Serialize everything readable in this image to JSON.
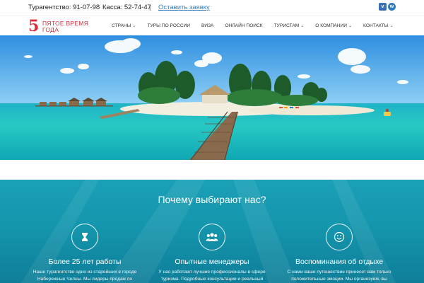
{
  "topbar": {
    "agency_phone": "Турагентство: 91-07-98",
    "cashier_phone": "Касса: 52-74-47",
    "separator": "|",
    "request_link": "Оставить заявку",
    "vimeo_letter": "v",
    "whatsapp_letter": "w"
  },
  "logo": {
    "number": "5",
    "text": "ПЯТОЕ ВРЕМЯ ГОДА"
  },
  "nav": {
    "items": [
      {
        "label": "СТРАНЫ",
        "dropdown": true
      },
      {
        "label": "ТУРЫ ПО РОССИИ",
        "dropdown": false
      },
      {
        "label": "ВИЗА",
        "dropdown": false
      },
      {
        "label": "ОНЛАЙН ПОИСК",
        "dropdown": false
      },
      {
        "label": "ТУРИСТАМ",
        "dropdown": true
      },
      {
        "label": "О КОМПАНИИ",
        "dropdown": true
      },
      {
        "label": "КОНТАКТЫ",
        "dropdown": true
      }
    ],
    "chevron": "⌄"
  },
  "features": {
    "heading": "Почему выбирают нас?",
    "items": [
      {
        "icon": "hourglass-icon",
        "title": "Более 25 лет работы",
        "desc": "Наше турагентство одно из старейших в городе Набережные Челны. Мы лидеры продаж по"
      },
      {
        "icon": "group-icon",
        "title": "Опытные менеджеры",
        "desc": "У нас работают лучшие профессионалы в сфере туризма. Подробные консультации и реальный"
      },
      {
        "icon": "smile-icon",
        "title": "Воспоминания об отдыхе",
        "desc": "С нами ваше путешествие принесет вам только положительные эмоции. Мы организуем, вы"
      }
    ]
  },
  "colors": {
    "brand_red": "#d92d3a",
    "link_blue": "#3a7fbf",
    "section_teal": "#1496ad"
  }
}
